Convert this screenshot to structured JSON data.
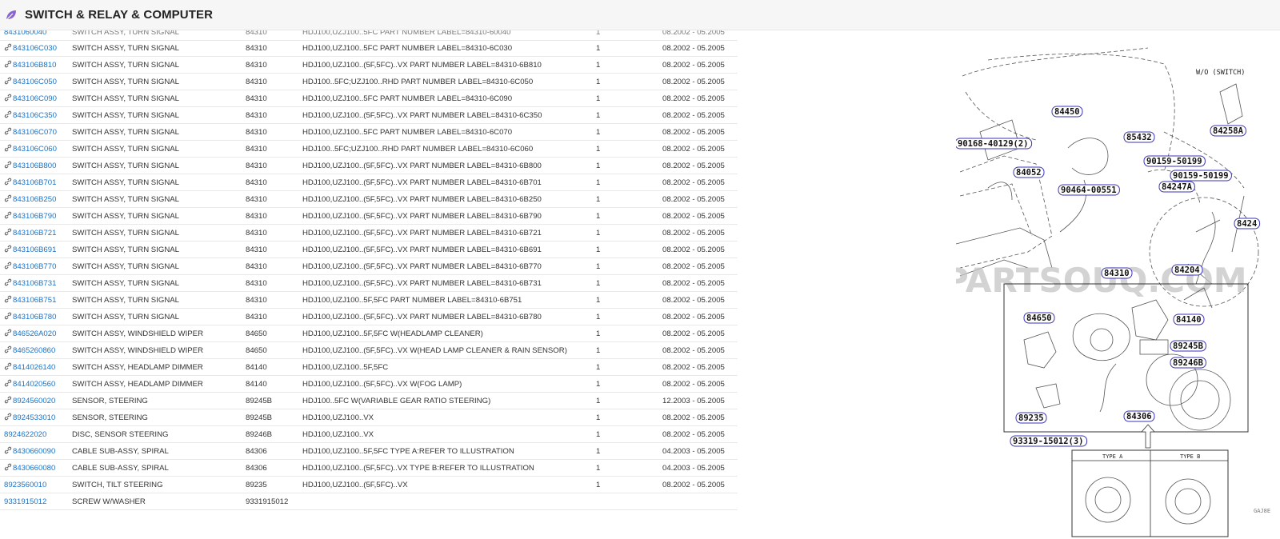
{
  "header": {
    "title": "SWITCH & RELAY & COMPUTER",
    "icon": "leaf-icon",
    "accent": "#7b5ac6"
  },
  "table": {
    "partial_row": {
      "number": "8431060040",
      "name": "SWITCH ASSY, TURN SIGNAL",
      "code": "84310",
      "desc": "HDJ100,UZJ100..5FC PART NUMBER LABEL=84310-60040",
      "qty": "1",
      "date": "08.2002 - 05.2005"
    },
    "rows": [
      {
        "number": "843106C030",
        "link": true,
        "name": "SWITCH ASSY, TURN SIGNAL",
        "code": "84310",
        "desc": "HDJ100,UZJ100..5FC PART NUMBER LABEL=84310-6C030",
        "qty": "1",
        "date": "08.2002 - 05.2005"
      },
      {
        "number": "843106B810",
        "link": true,
        "name": "SWITCH ASSY, TURN SIGNAL",
        "code": "84310",
        "desc": "HDJ100,UZJ100..(5F,5FC)..VX PART NUMBER LABEL=84310-6B810",
        "qty": "1",
        "date": "08.2002 - 05.2005"
      },
      {
        "number": "843106C050",
        "link": true,
        "name": "SWITCH ASSY, TURN SIGNAL",
        "code": "84310",
        "desc": "HDJ100..5FC;UZJ100..RHD PART NUMBER LABEL=84310-6C050",
        "qty": "1",
        "date": "08.2002 - 05.2005"
      },
      {
        "number": "843106C090",
        "link": true,
        "name": "SWITCH ASSY, TURN SIGNAL",
        "code": "84310",
        "desc": "HDJ100,UZJ100..5FC PART NUMBER LABEL=84310-6C090",
        "qty": "1",
        "date": "08.2002 - 05.2005"
      },
      {
        "number": "843106C350",
        "link": true,
        "name": "SWITCH ASSY, TURN SIGNAL",
        "code": "84310",
        "desc": "HDJ100,UZJ100..(5F,5FC)..VX PART NUMBER LABEL=84310-6C350",
        "qty": "1",
        "date": "08.2002 - 05.2005"
      },
      {
        "number": "843106C070",
        "link": true,
        "name": "SWITCH ASSY, TURN SIGNAL",
        "code": "84310",
        "desc": "HDJ100,UZJ100..5FC PART NUMBER LABEL=84310-6C070",
        "qty": "1",
        "date": "08.2002 - 05.2005"
      },
      {
        "number": "843106C060",
        "link": true,
        "name": "SWITCH ASSY, TURN SIGNAL",
        "code": "84310",
        "desc": "HDJ100..5FC;UZJ100..RHD PART NUMBER LABEL=84310-6C060",
        "qty": "1",
        "date": "08.2002 - 05.2005"
      },
      {
        "number": "843106B800",
        "link": true,
        "name": "SWITCH ASSY, TURN SIGNAL",
        "code": "84310",
        "desc": "HDJ100,UZJ100..(5F,5FC)..VX PART NUMBER LABEL=84310-6B800",
        "qty": "1",
        "date": "08.2002 - 05.2005"
      },
      {
        "number": "843106B701",
        "link": true,
        "name": "SWITCH ASSY, TURN SIGNAL",
        "code": "84310",
        "desc": "HDJ100,UZJ100..(5F,5FC)..VX PART NUMBER LABEL=84310-6B701",
        "qty": "1",
        "date": "08.2002 - 05.2005"
      },
      {
        "number": "843106B250",
        "link": true,
        "name": "SWITCH ASSY, TURN SIGNAL",
        "code": "84310",
        "desc": "HDJ100,UZJ100..(5F,5FC)..VX PART NUMBER LABEL=84310-6B250",
        "qty": "1",
        "date": "08.2002 - 05.2005"
      },
      {
        "number": "843106B790",
        "link": true,
        "name": "SWITCH ASSY, TURN SIGNAL",
        "code": "84310",
        "desc": "HDJ100,UZJ100..(5F,5FC)..VX PART NUMBER LABEL=84310-6B790",
        "qty": "1",
        "date": "08.2002 - 05.2005"
      },
      {
        "number": "843106B721",
        "link": true,
        "name": "SWITCH ASSY, TURN SIGNAL",
        "code": "84310",
        "desc": "HDJ100,UZJ100..(5F,5FC)..VX PART NUMBER LABEL=84310-6B721",
        "qty": "1",
        "date": "08.2002 - 05.2005"
      },
      {
        "number": "843106B691",
        "link": true,
        "name": "SWITCH ASSY, TURN SIGNAL",
        "code": "84310",
        "desc": "HDJ100,UZJ100..(5F,5FC)..VX PART NUMBER LABEL=84310-6B691",
        "qty": "1",
        "date": "08.2002 - 05.2005"
      },
      {
        "number": "843106B770",
        "link": true,
        "name": "SWITCH ASSY, TURN SIGNAL",
        "code": "84310",
        "desc": "HDJ100,UZJ100..(5F,5FC)..VX PART NUMBER LABEL=84310-6B770",
        "qty": "1",
        "date": "08.2002 - 05.2005"
      },
      {
        "number": "843106B731",
        "link": true,
        "name": "SWITCH ASSY, TURN SIGNAL",
        "code": "84310",
        "desc": "HDJ100,UZJ100..(5F,5FC)..VX PART NUMBER LABEL=84310-6B731",
        "qty": "1",
        "date": "08.2002 - 05.2005"
      },
      {
        "number": "843106B751",
        "link": true,
        "name": "SWITCH ASSY, TURN SIGNAL",
        "code": "84310",
        "desc": "HDJ100,UZJ100..5F,5FC PART NUMBER LABEL=84310-6B751",
        "qty": "1",
        "date": "08.2002 - 05.2005"
      },
      {
        "number": "843106B780",
        "link": true,
        "name": "SWITCH ASSY, TURN SIGNAL",
        "code": "84310",
        "desc": "HDJ100,UZJ100..(5F,5FC)..VX PART NUMBER LABEL=84310-6B780",
        "qty": "1",
        "date": "08.2002 - 05.2005"
      },
      {
        "number": "846526A020",
        "link": true,
        "name": "SWITCH ASSY, WINDSHIELD WIPER",
        "code": "84650",
        "desc": "HDJ100,UZJ100..5F,5FC W(HEADLAMP CLEANER)",
        "qty": "1",
        "date": "08.2002 - 05.2005"
      },
      {
        "number": "8465260860",
        "link": true,
        "name": "SWITCH ASSY, WINDSHIELD WIPER",
        "code": "84650",
        "desc": "HDJ100,UZJ100..(5F,5FC)..VX W(HEAD LAMP CLEANER & RAIN SENSOR)",
        "qty": "1",
        "date": "08.2002 - 05.2005"
      },
      {
        "number": "8414026140",
        "link": true,
        "name": "SWITCH ASSY, HEADLAMP DIMMER",
        "code": "84140",
        "desc": "HDJ100,UZJ100..5F,5FC",
        "qty": "1",
        "date": "08.2002 - 05.2005"
      },
      {
        "number": "8414020560",
        "link": true,
        "name": "SWITCH ASSY, HEADLAMP DIMMER",
        "code": "84140",
        "desc": "HDJ100,UZJ100..(5F,5FC)..VX W(FOG LAMP)",
        "qty": "1",
        "date": "08.2002 - 05.2005"
      },
      {
        "number": "8924560020",
        "link": true,
        "name": "SENSOR, STEERING",
        "code": "89245B",
        "desc": "HDJ100..5FC W(VARIABLE GEAR RATIO STEERING)",
        "qty": "1",
        "date": "12.2003 - 05.2005"
      },
      {
        "number": "8924533010",
        "link": true,
        "name": "SENSOR, STEERING",
        "code": "89245B",
        "desc": "HDJ100,UZJ100..VX",
        "qty": "1",
        "date": "08.2002 - 05.2005"
      },
      {
        "number": "8924622020",
        "link": false,
        "name": "DISC, SENSOR STEERING",
        "code": "89246B",
        "desc": "HDJ100,UZJ100..VX",
        "qty": "1",
        "date": "08.2002 - 05.2005"
      },
      {
        "number": "8430660090",
        "link": true,
        "name": "CABLE SUB-ASSY, SPIRAL",
        "code": "84306",
        "desc": "HDJ100,UZJ100..5F,5FC TYPE A:REFER TO ILLUSTRATION",
        "qty": "1",
        "date": "04.2003 - 05.2005"
      },
      {
        "number": "8430660080",
        "link": true,
        "name": "CABLE SUB-ASSY, SPIRAL",
        "code": "84306",
        "desc": "HDJ100,UZJ100..(5F,5FC)..VX TYPE B:REFER TO ILLUSTRATION",
        "qty": "1",
        "date": "04.2003 - 05.2005"
      },
      {
        "number": "8923560010",
        "link": false,
        "name": "SWITCH, TILT STEERING",
        "code": "89235",
        "desc": "HDJ100,UZJ100..(5F,5FC)..VX",
        "qty": "1",
        "date": "08.2002 - 05.2005"
      },
      {
        "number": "9331915012",
        "link": false,
        "name": "SCREW W/WASHER",
        "code": "9331915012",
        "desc": "",
        "qty": "",
        "date": ""
      }
    ]
  },
  "diagram": {
    "watermark": "PARTSOUQ.COM",
    "inset_label": "W/O (SWITCH)",
    "type_a": "TYPE A",
    "type_b": "TYPE B",
    "callouts": [
      "84450",
      "85432",
      "90168-40129(2)",
      "84052",
      "90464-00551",
      "84258A",
      "90159-50199",
      "90159-50199",
      "84247A",
      "8424",
      "84310",
      "84204",
      "84650",
      "84140",
      "89245B",
      "89246B",
      "89235",
      "84306",
      "93319-15012(3)"
    ],
    "corner_code": "GAJ8E"
  }
}
